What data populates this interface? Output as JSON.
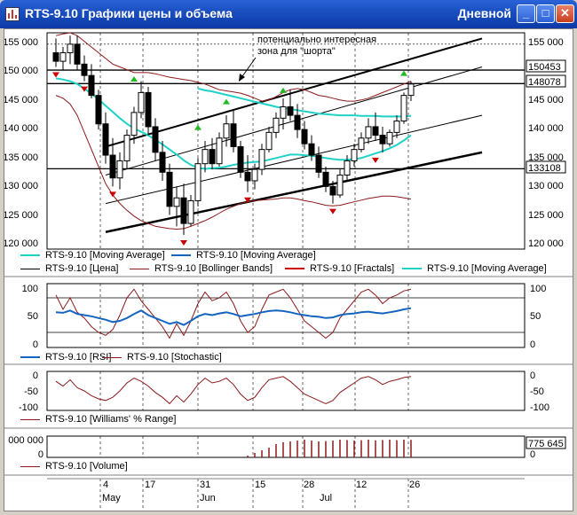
{
  "window": {
    "title": "RTS-9.10 Графики цены и объема",
    "timeframe": "Дневной",
    "buttons": {
      "minimize": "_",
      "maximize": "□",
      "close": "✕"
    }
  },
  "colors": {
    "price": "#000000",
    "ma_short": "#1ed2c8",
    "ma_long": "#1565c0",
    "bollinger": "#8b1a1a",
    "fractals": "#cc0000",
    "fractal_up": "#22bb22",
    "rsi": "#1565c0",
    "stochastic": "#8b1a1a",
    "williams": "#8b1a1a",
    "volume": "#8b1a1a"
  },
  "annotation": {
    "line1": "потенциально интересная",
    "line2": "зона для \"шорта\""
  },
  "price_axis": {
    "left_ticks": [
      "155 000",
      "150 000",
      "145 000",
      "140 000",
      "135 000",
      "130 000",
      "125 000",
      "120 000"
    ],
    "right_ticks": [
      "155 000",
      "145 000",
      "140 000",
      "135 000",
      "130 000",
      "125 000",
      "120 000"
    ],
    "levels": [
      "150453",
      "148078",
      "133108"
    ]
  },
  "legend_price": {
    "row1": [
      "RTS-9.10 [Moving Average]",
      "RTS-9.10 [Moving Average]"
    ],
    "row2": [
      "RTS-9.10 [Цена]",
      "RTS-9.10 [Bollinger Bands]",
      "RTS-9.10 [Fractals]",
      "RTS-9.10 [Moving Average]"
    ]
  },
  "osc_axis": {
    "left": [
      "100",
      "50",
      "0"
    ],
    "right": [
      "100",
      "50",
      "0"
    ]
  },
  "legend_osc": [
    "RTS-9.10 [RSI]",
    "RTS-9.10 [Stochastic]"
  ],
  "wpr_axis": {
    "left": [
      "0",
      "-50",
      "-100"
    ],
    "right": [
      "0",
      "-50",
      "-100"
    ]
  },
  "legend_wpr": [
    "RTS-9.10 [Williams' % Range]"
  ],
  "volume_axis": {
    "left": "000 000",
    "left_zero": "0",
    "right_value": "775 645",
    "right_zero": "0"
  },
  "legend_volume": [
    "RTS-9.10 [Volume]"
  ],
  "date_axis": {
    "days": [
      "4",
      "17",
      "31",
      "15",
      "28",
      "12",
      "26"
    ],
    "months": [
      "May",
      "Jun",
      "Jul"
    ]
  },
  "chart_data": {
    "type": "candlestick",
    "ylim": [
      119000,
      157000
    ],
    "candles": [
      [
        153500,
        156000,
        151000,
        152000
      ],
      [
        152000,
        154500,
        150500,
        153500
      ],
      [
        153500,
        156500,
        151500,
        155000
      ],
      [
        155000,
        156500,
        150500,
        151500
      ],
      [
        151500,
        153000,
        148500,
        149500
      ],
      [
        149500,
        151500,
        145500,
        146000
      ],
      [
        146000,
        147000,
        140000,
        141000
      ],
      [
        141000,
        143000,
        134000,
        135500
      ],
      [
        135500,
        138500,
        130000,
        131500
      ],
      [
        131500,
        136000,
        129500,
        134500
      ],
      [
        134500,
        140000,
        133000,
        139000
      ],
      [
        139000,
        144000,
        137500,
        143000
      ],
      [
        143000,
        148500,
        142000,
        146500
      ],
      [
        146500,
        147500,
        139000,
        140500
      ],
      [
        140500,
        142000,
        134500,
        136000
      ],
      [
        136000,
        138000,
        131000,
        132500
      ],
      [
        132500,
        134000,
        125000,
        126500
      ],
      [
        126500,
        130000,
        123000,
        128000
      ],
      [
        128000,
        130500,
        121500,
        123500
      ],
      [
        123500,
        128500,
        123000,
        127500
      ],
      [
        127500,
        135000,
        126500,
        134000
      ],
      [
        134000,
        138000,
        132500,
        136500
      ],
      [
        136500,
        138500,
        133000,
        134000
      ],
      [
        134000,
        139500,
        133500,
        138500
      ],
      [
        138500,
        142500,
        137000,
        141000
      ],
      [
        141000,
        143500,
        136000,
        137000
      ],
      [
        137000,
        138000,
        131500,
        132500
      ],
      [
        132500,
        135500,
        129000,
        131000
      ],
      [
        131000,
        134000,
        129500,
        133000
      ],
      [
        133000,
        137500,
        132000,
        136500
      ],
      [
        136500,
        140500,
        136000,
        139500
      ],
      [
        139500,
        143000,
        138500,
        142000
      ],
      [
        142000,
        145500,
        140000,
        144000
      ],
      [
        144000,
        147000,
        141500,
        142500
      ],
      [
        142500,
        144500,
        138500,
        140000
      ],
      [
        140000,
        141500,
        136500,
        137500
      ],
      [
        137500,
        139000,
        134500,
        135500
      ],
      [
        135500,
        137000,
        131500,
        132500
      ],
      [
        132500,
        133500,
        129000,
        130000
      ],
      [
        130000,
        131000,
        127000,
        128500
      ],
      [
        128500,
        133000,
        128000,
        132000
      ],
      [
        132000,
        135500,
        131000,
        134500
      ],
      [
        134500,
        137500,
        133500,
        136500
      ],
      [
        136500,
        139500,
        136000,
        138500
      ],
      [
        138500,
        142000,
        137500,
        140500
      ],
      [
        140500,
        143000,
        138000,
        139000
      ],
      [
        139000,
        140500,
        136000,
        137500
      ],
      [
        137500,
        140000,
        137000,
        139500
      ],
      [
        139500,
        142500,
        138500,
        141500
      ],
      [
        141500,
        146500,
        141000,
        146000
      ],
      [
        146000,
        148500,
        145000,
        148000
      ]
    ],
    "ma_short": [
      149000,
      148800,
      148500,
      148000,
      147200,
      146300,
      145300,
      144200,
      143100,
      142000,
      141000,
      140200,
      139600,
      139000,
      138200,
      137400,
      136500,
      135600,
      134600,
      133800,
      133300,
      133100,
      133200,
      133300,
      133500,
      133800,
      134000,
      134200,
      134300,
      134400,
      134700,
      135000,
      135300,
      135600,
      135600,
      135500,
      135400,
      135200,
      135000,
      134800,
      134700,
      134700,
      134800,
      135000,
      135400,
      135800,
      136200,
      136700,
      137300,
      138100,
      139000
    ],
    "ma_long": [
      null,
      null,
      null,
      null,
      null,
      null,
      null,
      null,
      null,
      null,
      null,
      null,
      null,
      null,
      null,
      null,
      null,
      null,
      null,
      null,
      147200,
      146900,
      146700,
      146400,
      146100,
      145800,
      145500,
      145200,
      144900,
      144600,
      144300,
      144000,
      143800,
      143600,
      143400,
      143200,
      143000,
      142800,
      142700,
      142600,
      142500,
      142500,
      142500,
      142400,
      142400,
      142400,
      142300,
      142300,
      142300,
      142300,
      142400
    ],
    "bollinger_upper": [
      156500,
      156800,
      157000,
      156500,
      155500,
      154500,
      153500,
      152500,
      151500,
      151000,
      150500,
      150000,
      150000,
      150000,
      149800,
      149500,
      149200,
      149000,
      148800,
      148600,
      148300,
      148000,
      147500,
      147000,
      146800,
      146600,
      146400,
      146000,
      145500,
      145000,
      145200,
      145800,
      146500,
      147000,
      147200,
      147000,
      146500,
      146000,
      145800,
      145500,
      145200,
      145000,
      145000,
      145200,
      145500,
      146000,
      146500,
      147000,
      147500,
      148000,
      148500
    ],
    "bollinger_lower": [
      146000,
      145500,
      144500,
      142500,
      139500,
      136500,
      133500,
      130500,
      128500,
      127000,
      125800,
      124800,
      124000,
      123500,
      123000,
      122800,
      122600,
      122500,
      122600,
      123000,
      123500,
      124000,
      124600,
      125300,
      126000,
      126500,
      127000,
      127300,
      127500,
      127600,
      127700,
      127800,
      128000,
      128000,
      127800,
      127500,
      127300,
      127000,
      126700,
      126600,
      126700,
      127000,
      127300,
      127600,
      127900,
      128100,
      128300,
      128300,
      128200,
      128000,
      127800
    ],
    "fractals_down": [
      [
        0,
        151000
      ],
      [
        4,
        148500
      ],
      [
        8,
        130000
      ],
      [
        18,
        121500
      ],
      [
        27,
        129000
      ],
      [
        39,
        127000
      ],
      [
        45,
        136000
      ]
    ],
    "fractals_up": [
      [
        11,
        147500
      ],
      [
        20,
        139000
      ],
      [
        24,
        143500
      ],
      [
        32,
        145500
      ],
      [
        49,
        148500
      ]
    ],
    "rsi": [
      55,
      54,
      58,
      52,
      50,
      48,
      45,
      42,
      38,
      40,
      45,
      52,
      58,
      50,
      45,
      40,
      35,
      38,
      33,
      40,
      48,
      52,
      50,
      53,
      55,
      52,
      48,
      50,
      52,
      55,
      57,
      58,
      57,
      55,
      52,
      50,
      48,
      47,
      45,
      46,
      50,
      52,
      53,
      55,
      56,
      54,
      53,
      55,
      57,
      60,
      62
    ],
    "stochastic": [
      85,
      60,
      80,
      55,
      45,
      30,
      20,
      15,
      25,
      50,
      80,
      95,
      75,
      60,
      45,
      30,
      10,
      35,
      15,
      40,
      70,
      90,
      75,
      80,
      90,
      70,
      40,
      20,
      30,
      60,
      85,
      90,
      95,
      80,
      60,
      40,
      30,
      20,
      10,
      20,
      45,
      60,
      75,
      90,
      95,
      85,
      70,
      80,
      85,
      92,
      95
    ],
    "williams": [
      -20,
      -35,
      -15,
      -40,
      -50,
      -65,
      -75,
      -80,
      -70,
      -50,
      -25,
      -10,
      -20,
      -35,
      -55,
      -70,
      -90,
      -65,
      -85,
      -60,
      -30,
      -10,
      -25,
      -20,
      -10,
      -30,
      -60,
      -80,
      -70,
      -40,
      -15,
      -10,
      -5,
      -20,
      -40,
      -60,
      -70,
      -80,
      -90,
      -80,
      -55,
      -40,
      -25,
      -10,
      -5,
      -15,
      -30,
      -20,
      -15,
      -8,
      -5
    ],
    "volume": [
      0,
      0,
      0,
      0,
      0,
      0,
      0,
      0,
      0,
      0,
      0,
      0,
      0,
      0,
      0,
      0,
      0,
      0,
      0,
      0,
      0,
      0,
      0,
      0,
      0,
      0,
      0,
      0.1,
      0.25,
      0.4,
      0.55,
      0.75,
      0.85,
      0.9,
      0.95,
      1,
      0.95,
      0.9,
      0.92,
      0.95,
      1,
      0.98,
      0.95,
      0.97,
      1,
      0.96,
      0.98,
      1,
      0.97,
      1,
      0.99
    ],
    "channel_lines": [
      {
        "x1": 7,
        "y1": 137000,
        "x2": 60,
        "y2": 156000,
        "w": 2
      },
      {
        "x1": 7,
        "y1": 132000,
        "x2": 60,
        "y2": 151000,
        "w": 1
      },
      {
        "x1": 7,
        "y1": 127000,
        "x2": 60,
        "y2": 142500,
        "w": 1
      },
      {
        "x1": 7,
        "y1": 122000,
        "x2": 60,
        "y2": 136000,
        "w": 2.5
      }
    ]
  }
}
